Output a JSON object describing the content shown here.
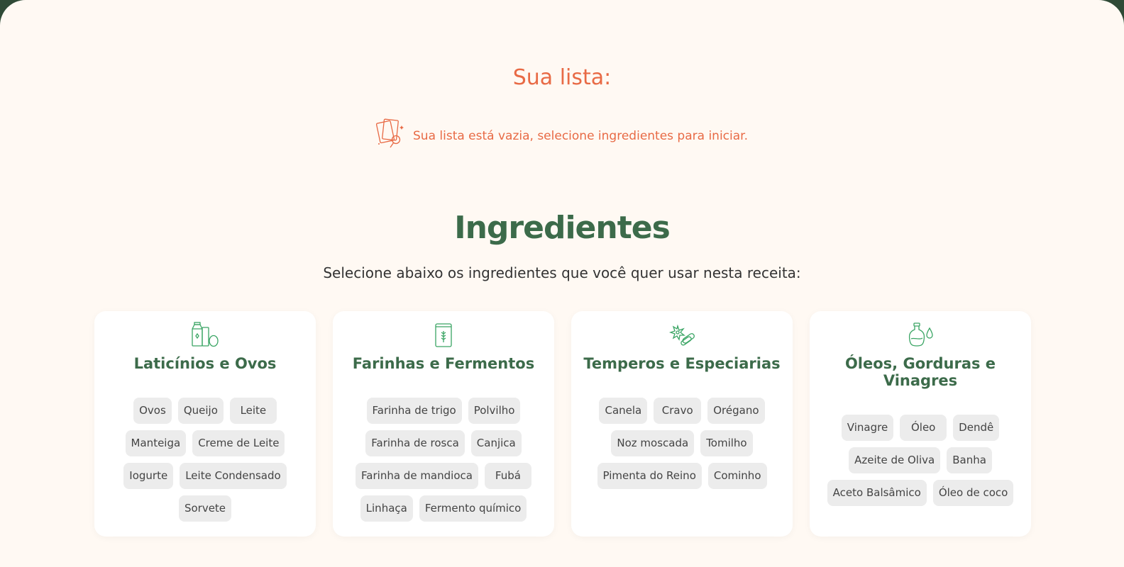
{
  "list": {
    "title": "Sua lista:",
    "empty_message": "Sua lista está vazia, selecione ingredientes para iniciar.",
    "empty_icon": "empty-list-search-icon"
  },
  "ingredients": {
    "title": "Ingredientes",
    "subtitle": "Selecione abaixo os ingredientes que você quer usar nesta receita:"
  },
  "colors": {
    "accent": "#e86a45",
    "green": "#3c6b4a",
    "background": "#fff9f3",
    "frame": "#2f4a36",
    "tag_bg": "#ececec"
  },
  "categories": [
    {
      "name": "Laticínios e Ovos",
      "icon": "milk-egg-icon",
      "items": [
        "Ovos",
        "Queijo",
        "Leite",
        "Manteiga",
        "Creme de Leite",
        "Iogurte",
        "Leite Condensado",
        "Sorvete"
      ]
    },
    {
      "name": "Farinhas e Fermentos",
      "icon": "flour-bag-icon",
      "items": [
        "Farinha de trigo",
        "Polvilho",
        "Farinha de rosca",
        "Canjica",
        "Farinha de mandioca",
        "Fubá",
        "Linhaça",
        "Fermento químico"
      ]
    },
    {
      "name": "Temperos e Especiarias",
      "icon": "spices-icon",
      "items": [
        "Canela",
        "Cravo",
        "Orégano",
        "Noz moscada",
        "Tomilho",
        "Pimenta do Reino",
        "Cominho"
      ]
    },
    {
      "name": "Óleos, Gorduras e Vinagres",
      "icon": "oil-bottle-icon",
      "items": [
        "Vinagre",
        "Óleo",
        "Dendê",
        "Azeite de Oliva",
        "Banha",
        "Aceto Balsâmico",
        "Óleo de coco"
      ]
    }
  ]
}
